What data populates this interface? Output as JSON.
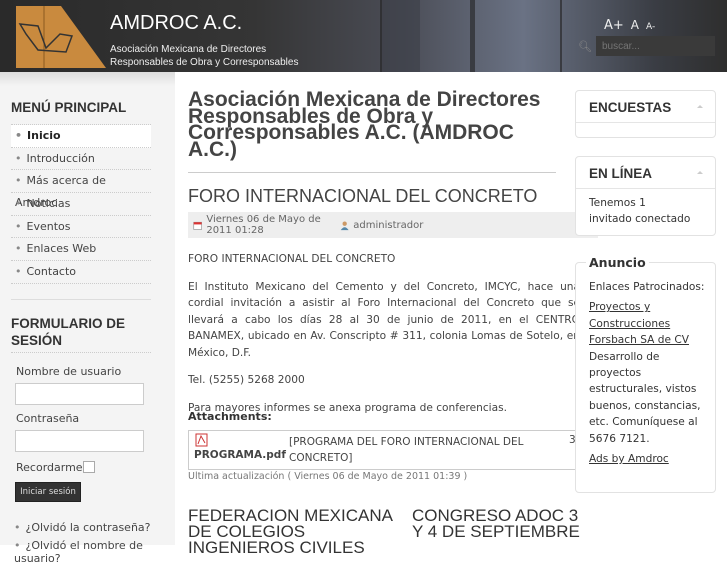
{
  "header": {
    "site_name": "AMDROC A.C.",
    "subtitle_line1": "Asociación Mexicana de Directores",
    "subtitle_line2": "Responsables de Obra y Corresponsables",
    "font_increase": "A+",
    "font_reset": "A",
    "font_decrease": "A-",
    "search_placeholder": "buscar..."
  },
  "sidebar": {
    "menu_title": "MENÚ PRINCIPAL",
    "menu": [
      {
        "label": "Inicio",
        "active": true
      },
      {
        "label": "Introducción"
      },
      {
        "label": "Más acerca de Amdroc"
      },
      {
        "label": "Noticias"
      },
      {
        "label": "Eventos"
      },
      {
        "label": "Enlaces Web"
      },
      {
        "label": "Contacto"
      }
    ],
    "login": {
      "title": "FORMULARIO DE SESIÓN",
      "username_label": "Nombre de usuario",
      "password_label": "Contraseña",
      "remember_label": "Recordarme",
      "submit": "Iniciar sesión",
      "forgot_password": "¿Olvidó la contraseña?",
      "forgot_username": "¿Olvidó el nombre de usuario?"
    }
  },
  "main": {
    "page_title": "Asociación Mexicana de Directores Responsables de Obra y Corresponsables A.C. (AMDROC A.C.)",
    "article_title": "FORO INTERNACIONAL DEL CONCRETO",
    "date": "Viernes 06 de Mayo de 2011 01:28",
    "author": "administrador",
    "paragraphs": [
      "FORO INTERNACIONAL DEL CONCRETO",
      "El Instituto Mexicano del Cemento y del Concreto, IMCYC, hace una cordial invitación a asistir al Foro Internacional del Concreto que se llevará a cabo los días 28 al 30 de junio de 2011, en el CENTRO BANAMEX, ubicado en Av. Conscripto # 311, colonia Lomas de Sotelo, en México, D.F.",
      "Tel. (5255) 5268 2000",
      "Para mayores informes se anexa programa de conferencias."
    ],
    "attachments_label": "Attachments:",
    "attachment": {
      "file": "PROGRAMA.pdf",
      "description": "[PROGRAMA DEL FORO INTERNACIONAL DEL CONCRETO]",
      "size": "3"
    },
    "updated": "Ultima actualización ( Viernes 06 de Mayo de 2011 01:39 )",
    "next_articles": [
      "FEDERACION MEXICANA DE COLEGIOS INGENIEROS CIVILES",
      "CONGRESO ADOC 3 Y 4 DE SEPTIEMBRE"
    ]
  },
  "right": {
    "polls_title": "ENCUESTAS",
    "online_title": "EN LÍNEA",
    "online_line1": "Tenemos 1",
    "online_line2": "invitado conectado",
    "ad": {
      "title": "Anuncio",
      "intro": "Enlaces Patrocinados:",
      "link": "Proyectos y Construcciones Forsbach SA de CV",
      "text": "Desarrollo de proyectos estructurales, vistos buenos, constancias, etc. Comuníquese al 5676 7121.",
      "ads_by": "Ads by Amdroc"
    }
  }
}
